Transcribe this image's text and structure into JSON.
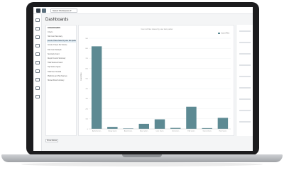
{
  "topbar": {
    "workspace_select": "Select Workspace ▾"
  },
  "page": {
    "title": "Dashboards"
  },
  "list_panel": {
    "heading": "DASHBOARDS",
    "sub": "Charts",
    "items": [
      {
        "label": "Tab Count Summary",
        "active": false
      },
      {
        "label": "Count of files shared by user last quarter",
        "active": true
      },
      {
        "label": "Count of Users Per Source",
        "active": false
      },
      {
        "label": "File Count Analysis",
        "active": false
      },
      {
        "label": "Summary Count",
        "active": false
      },
      {
        "label": "Report Counts Summary",
        "active": false
      },
      {
        "label": "Total Sources Found",
        "active": false
      },
      {
        "label": "Top Source Types",
        "active": false
      },
      {
        "label": "Total User Created",
        "active": false
      },
      {
        "label": "Platforms and Top Sources",
        "active": false
      },
      {
        "label": "Shared Files Summary",
        "active": false
      }
    ]
  },
  "footer": {
    "select": "Show Allows"
  },
  "chart_data": {
    "type": "bar",
    "title": "Count of files shared by user last quarter",
    "legend": "Count Files",
    "ylabel": "Count Files",
    "ylim": [
      0,
      900
    ],
    "categories": [
      "Admin Users",
      "Group Users",
      "Anon Users",
      "Base Users",
      "Core Users",
      "Dev Users",
      "Edit Users",
      "Guest Users",
      "Host Users"
    ],
    "values": [
      820,
      20,
      5,
      50,
      95,
      10,
      220,
      8,
      110
    ],
    "color": "#5d8a93"
  },
  "side_panel": {
    "item_count": 9
  }
}
